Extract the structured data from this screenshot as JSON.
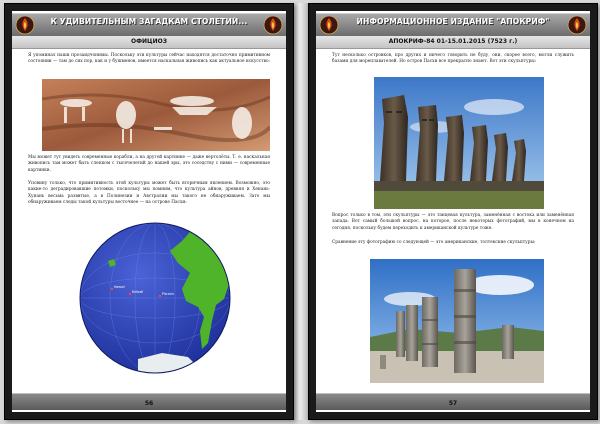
{
  "left_page": {
    "header_title": "К УДИВИТЕЛЬНЫМ ЗАГАДКАМ СТОЛЕТИЙ...",
    "section": "ОФИЦИОЗ",
    "intro_text": "Я упоминал наши прозаидчонимы. Поскольку эти культуры сейчас находятся достаточно примитивном состоянии — там до сих пор, как и у бушменов, имеется наскальная живопись как актуальное искусство:",
    "middle_text": "Мы может тут увидеть современные корабли, а на другой картинке — даже вертолёты. Т. е. наскальная живопись там может быть слепком с тысячелетий до нашей эры, это соседству с ними — современные картинки.",
    "bottom_text": "Уповину только, что примитивность этой культуры может быть вторичным явлением. Возможно, это какие-то деградировавшие потомки, поскольку мы помним, что культура айнов, древняя и Хенань-Хунань весьма развитые, а в Полинезии и Австралии мы такого не обнаруживаем. Зато мы обнаруживаем следы такой культуры восточнее — на острове Пасхи:",
    "page_number": "56"
  },
  "right_page": {
    "header_title": "ИНФОРМАЦИОННОЕ ИЗДАНИЕ \"АПОКРИФ\"",
    "section": "АПОКРИФ-84 01-15.01.2015 (7523 г.)",
    "intro_text": "Тут несколько островков, про других и ничего говорить не буду, они, скорее всего, могли служить базами для мореплавателей. Но остров Пасхи все прекрасно знают. Вот эти скульптуры:",
    "middle_text": "Вопрос только в том, эти скульптуры — это танцевая культура, заменённая с востока или заменённая запада. Вот самый большой вопрос, на которое, после некоторых фотографий, мы в конечном на сегодня, поскольку будем переходить к американской культуре тоже.",
    "bottom_text": "Сравнение эту фотографию со следующей — это американские, толтекские скульптуры:",
    "page_number": "57"
  },
  "icons": {
    "logo": "flame-emblem-icon"
  },
  "colors": {
    "frame": "#1a1a1a",
    "header_bar": "#7a7a7a",
    "globe_ocean": "#2b43b8",
    "globe_land": "#4fb42a"
  }
}
